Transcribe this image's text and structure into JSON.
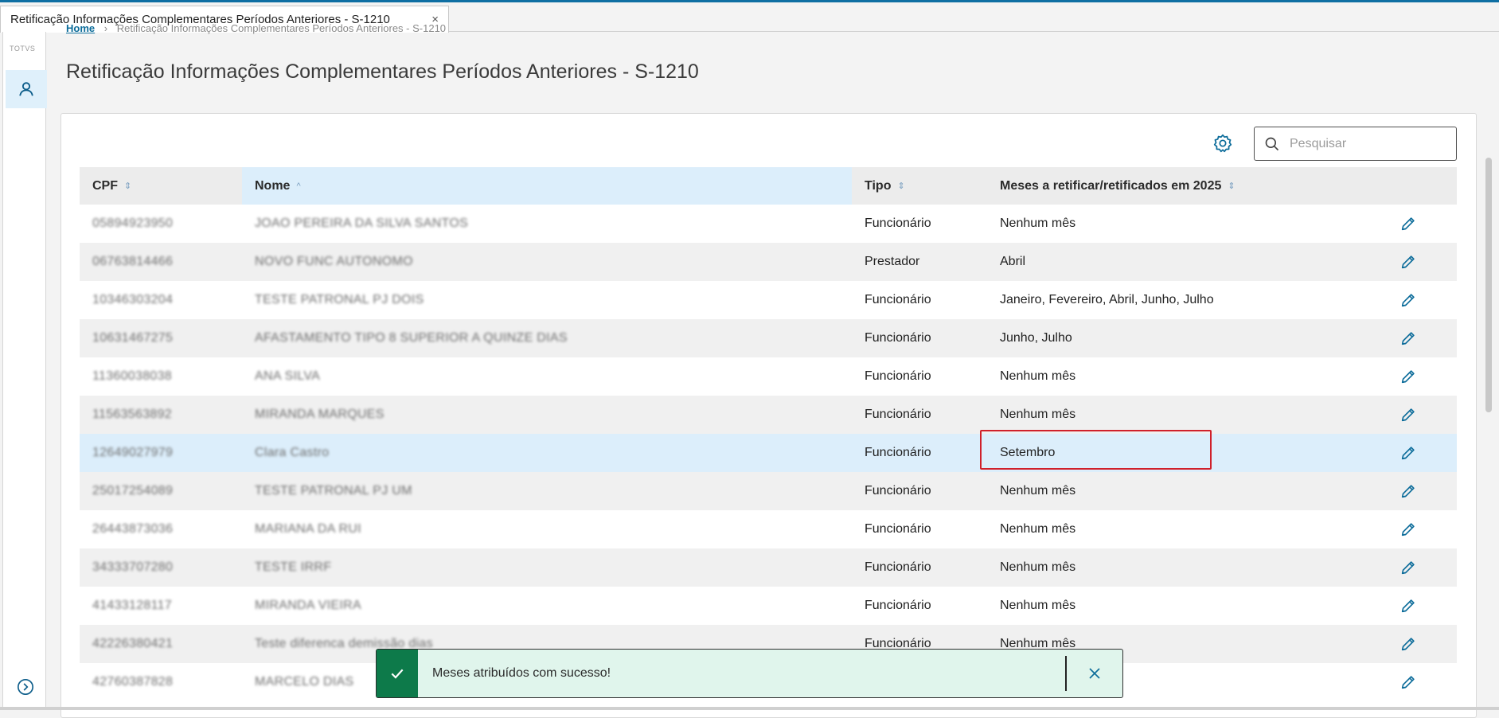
{
  "window": {
    "tab_title": "Retificação Informações Complementares Períodos Anteriores - S-1210",
    "tab_close": "×"
  },
  "sidebar": {
    "logo_text": "TOTVS",
    "user_icon": "user-icon",
    "expand_icon": "chevron-right-circle-icon"
  },
  "breadcrumb": {
    "home": "Home",
    "separator": "›",
    "current": "Retificação Informações Complementares Períodos Anteriores - S-1210"
  },
  "page": {
    "title": "Retificação Informações Complementares Períodos Anteriores - S-1210"
  },
  "toolbar": {
    "settings_icon": "gear-icon",
    "search_placeholder": "Pesquisar",
    "search_value": ""
  },
  "table": {
    "columns": [
      {
        "label": "CPF",
        "sort": "⇕"
      },
      {
        "label": "Nome",
        "sort": "^"
      },
      {
        "label": "Tipo",
        "sort": "⇕"
      },
      {
        "label": "Meses a retificar/retificados em 2025",
        "sort": "⇕"
      },
      {
        "label": ""
      }
    ],
    "rows": [
      {
        "cpf": "05894923950",
        "nome": "JOAO PEREIRA DA SILVA SANTOS",
        "tipo": "Funcionário",
        "meses": "Nenhum mês"
      },
      {
        "cpf": "06763814466",
        "nome": "NOVO FUNC AUTONOMO",
        "tipo": "Prestador",
        "meses": "Abril"
      },
      {
        "cpf": "10346303204",
        "nome": "TESTE PATRONAL PJ DOIS",
        "tipo": "Funcionário",
        "meses": "Janeiro, Fevereiro, Abril, Junho, Julho"
      },
      {
        "cpf": "10631467275",
        "nome": "AFASTAMENTO TIPO 8 SUPERIOR A QUINZE DIAS",
        "tipo": "Funcionário",
        "meses": "Junho, Julho"
      },
      {
        "cpf": "11360038038",
        "nome": "ANA SILVA",
        "tipo": "Funcionário",
        "meses": "Nenhum mês"
      },
      {
        "cpf": "11563563892",
        "nome": "MIRANDA MARQUES",
        "tipo": "Funcionário",
        "meses": "Nenhum mês"
      },
      {
        "cpf": "12649027979",
        "nome": "Clara Castro",
        "tipo": "Funcionário",
        "meses": "Setembro"
      },
      {
        "cpf": "25017254089",
        "nome": "TESTE PATRONAL PJ UM",
        "tipo": "Funcionário",
        "meses": "Nenhum mês"
      },
      {
        "cpf": "26443873036",
        "nome": "MARIANA DA RUI",
        "tipo": "Funcionário",
        "meses": "Nenhum mês"
      },
      {
        "cpf": "34333707280",
        "nome": "TESTE IRRF",
        "tipo": "Funcionário",
        "meses": "Nenhum mês"
      },
      {
        "cpf": "41433128117",
        "nome": "MIRANDA VIEIRA",
        "tipo": "Funcionário",
        "meses": "Nenhum mês"
      },
      {
        "cpf": "42226380421",
        "nome": "Teste diferenca demissão dias",
        "tipo": "Funcionário",
        "meses": "Nenhum mês"
      },
      {
        "cpf": "42760387828",
        "nome": "MARCELO DIAS",
        "tipo": "",
        "meses": ""
      }
    ]
  },
  "toast": {
    "icon": "check-icon",
    "message": "Meses atribuídos com sucesso!",
    "close_icon": "close-icon"
  }
}
